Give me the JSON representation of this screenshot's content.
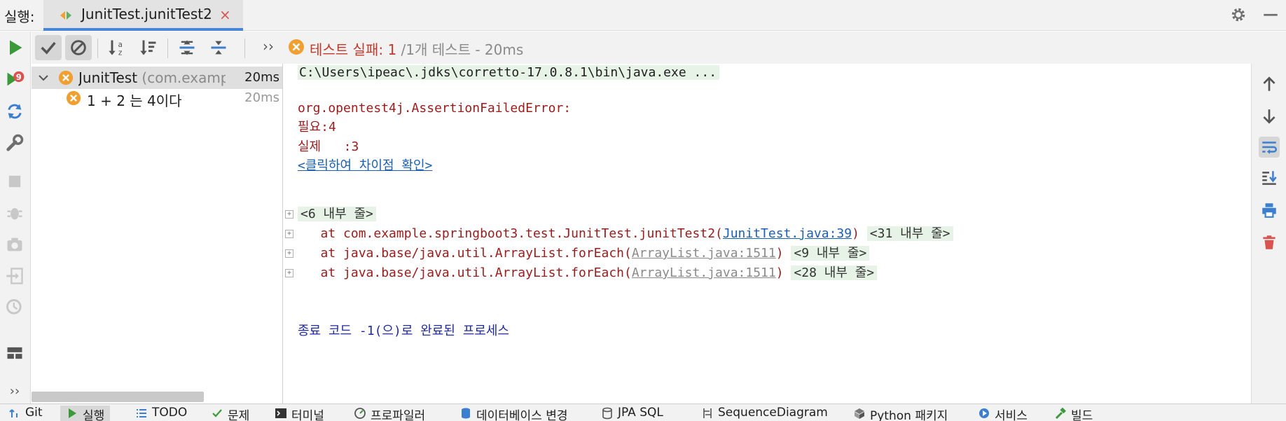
{
  "header": {
    "run_label": "실행:",
    "tab_title": "JunitTest.junitTest2",
    "tab_close": "×"
  },
  "toolbar": {
    "more": "››",
    "status_fail": "테스트 실패: 1",
    "status_rest": " /1개 테스트 - 20ms"
  },
  "tree": {
    "root": {
      "name": "JunitTest",
      "package": " (com.example.s",
      "time": "20ms"
    },
    "child": {
      "name": "1 + 2 는 4이다",
      "time": "20ms"
    }
  },
  "console": {
    "command": "C:\\Users\\ipeac\\.jdks\\corretto-17.0.8.1\\bin\\java.exe ...",
    "error_class": "org.opentest4j.AssertionFailedError:",
    "expected": "필요:4",
    "actual": "실제   :3",
    "diff_link": "<클릭하여 차이점 확인>",
    "internal_lines": "<6 내부 줄>",
    "frames": [
      {
        "prefix": "   at com.example.springboot3.test.JunitTest.junitTest2(",
        "link": "JunitTest.java:39",
        "suffix": ")",
        "fold": "<31 내부 줄>"
      },
      {
        "prefix": "   at java.base/java.util.ArrayList.forEach(",
        "link": "ArrayList.java:1511",
        "suffix": ")",
        "fold": "<9 내부 줄>"
      },
      {
        "prefix": "   at java.base/java.util.ArrayList.forEach(",
        "link": "ArrayList.java:1511",
        "suffix": ")",
        "fold": "<28 내부 줄>"
      }
    ],
    "exit_message": "종료 코드 -1(으)로 완료된 프로세스"
  },
  "left_bottom_more": "››",
  "bottom_bar": [
    {
      "label": "Git",
      "icon": "git-icon"
    },
    {
      "label": "실행",
      "icon": "run-icon",
      "active": true
    },
    {
      "label": "TODO",
      "icon": "todo-icon"
    },
    {
      "label": "문제",
      "icon": "problems-icon"
    },
    {
      "label": "터미널",
      "icon": "terminal-icon"
    },
    {
      "label": "프로파일러",
      "icon": "profiler-icon"
    },
    {
      "label": "데이터베이스 변경",
      "icon": "database-icon"
    },
    {
      "label": "JPA SQL",
      "icon": "jpa-icon"
    },
    {
      "label": "SequenceDiagram",
      "icon": "sequence-icon"
    },
    {
      "label": "Python 패키지",
      "icon": "python-packages-icon"
    },
    {
      "label": "서비스",
      "icon": "services-icon"
    },
    {
      "label": "빌드",
      "icon": "build-icon"
    }
  ],
  "colors": {
    "accent_blue": "#4a86d8",
    "fail_red": "#c0392b",
    "warning_orange": "#f0a030",
    "run_green": "#3a9a3a",
    "error_text": "#9c1a1a"
  }
}
